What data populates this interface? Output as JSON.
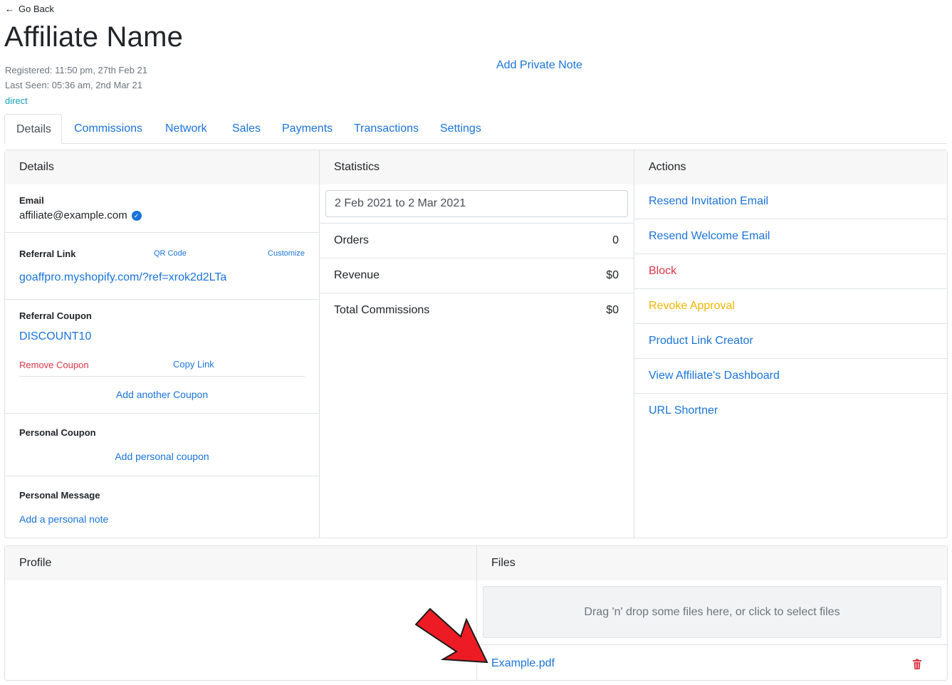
{
  "nav": {
    "back_label": "Go Back"
  },
  "header": {
    "title": "Affiliate Name",
    "registered": "Registered: 11:50 pm, 27th Feb 21",
    "last_seen": "Last Seen: 05:36 am, 2nd Mar 21",
    "source": "direct",
    "private_note": "Add Private Note"
  },
  "tabs": [
    "Details",
    "Commissions",
    "Network",
    "Sales",
    "Payments",
    "Transactions",
    "Settings"
  ],
  "details": {
    "heading": "Details",
    "email_label": "Email",
    "email": "affiliate@example.com",
    "referral_label": "Referral Link",
    "qr_code": "QR Code",
    "customize": "Customize",
    "referral_link": "goaffpro.myshopify.com/?ref=xrok2d2LTa",
    "coupon_label": "Referral Coupon",
    "coupon": "DISCOUNT10",
    "remove_coupon": "Remove Coupon",
    "copy_link": "Copy Link",
    "add_coupon": "Add another Coupon",
    "personal_coupon_label": "Personal Coupon",
    "add_personal_coupon": "Add personal coupon",
    "personal_message_label": "Personal Message",
    "add_personal_note": "Add a personal note"
  },
  "statistics": {
    "heading": "Statistics",
    "date_range": "2 Feb 2021 to 2 Mar 2021",
    "rows": [
      {
        "label": "Orders",
        "value": "0"
      },
      {
        "label": "Revenue",
        "value": "$0"
      },
      {
        "label": "Total Commissions",
        "value": "$0"
      }
    ]
  },
  "actions": {
    "heading": "Actions",
    "items": [
      {
        "label": "Resend Invitation Email",
        "color": "#1a73d9"
      },
      {
        "label": "Resend Welcome Email",
        "color": "#1a73d9"
      },
      {
        "label": "Block",
        "color": "#dc3545"
      },
      {
        "label": "Revoke Approval",
        "color": "#f0b400"
      },
      {
        "label": "Product Link Creator",
        "color": "#1a73d9"
      },
      {
        "label": "View Affiliate's Dashboard",
        "color": "#1a73d9"
      },
      {
        "label": "URL Shortner",
        "color": "#1a73d9"
      }
    ]
  },
  "profile": {
    "heading": "Profile"
  },
  "files": {
    "heading": "Files",
    "dropzone": "Drag 'n' drop some files here, or click to select files",
    "file_name": "Example.pdf"
  },
  "colors": {
    "link": "#1a73d9",
    "danger": "#dc3545",
    "warning": "#f0b400",
    "arrow": "#ed1c24"
  },
  "icons": {
    "back": "arrow-left-icon",
    "verified": "check-circle-icon",
    "delete": "trash-icon"
  }
}
